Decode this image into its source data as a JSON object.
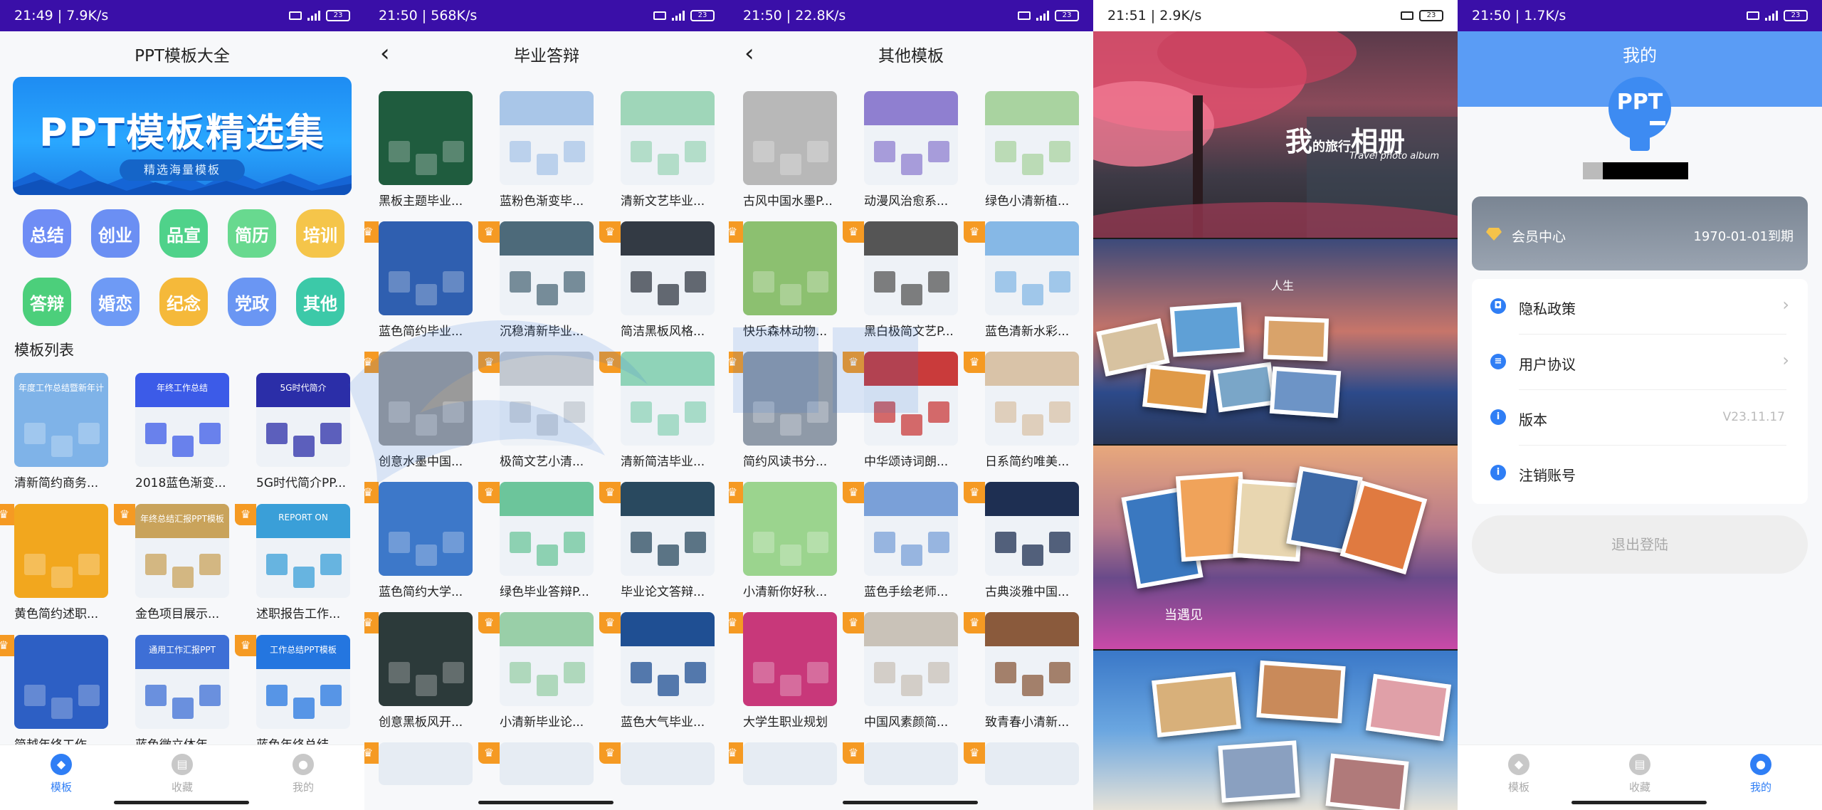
{
  "screens": [
    {
      "status": {
        "time": "21:49",
        "speed": "7.9K/s",
        "battery": "23"
      },
      "title": "PPT模板大全",
      "banner": {
        "title": "PPT模板精选集",
        "subtitle": "精选海量模板"
      },
      "categories": [
        {
          "label": "总结",
          "color": "#6f8df5"
        },
        {
          "label": "创业",
          "color": "#6b8ff3"
        },
        {
          "label": "品宣",
          "color": "#4fd28a"
        },
        {
          "label": "简历",
          "color": "#68d98f"
        },
        {
          "label": "培训",
          "color": "#f5c54a"
        },
        {
          "label": "答辩",
          "color": "#4ccf7b"
        },
        {
          "label": "婚恋",
          "color": "#6e9af5"
        },
        {
          "label": "纪念",
          "color": "#f5b93a"
        },
        {
          "label": "党政",
          "color": "#6a96f3"
        },
        {
          "label": "其他",
          "color": "#3cc9a8"
        }
      ],
      "section_title": "模板列表",
      "templates": [
        {
          "caption": "清新简约商务...",
          "vip": false,
          "theme": "#7fb3e8",
          "text": "年度工作总结暨新年计划"
        },
        {
          "caption": "2018蓝色渐变...",
          "vip": false,
          "theme": "#3c5be8",
          "text": "年终工作总结"
        },
        {
          "caption": "5G时代简介PP...",
          "vip": false,
          "theme": "#2b2ea8",
          "text": "5G时代简介"
        },
        {
          "caption": "黄色简约述职...",
          "vip": true,
          "theme": "#f2a71e",
          "text": ""
        },
        {
          "caption": "金色项目展示...",
          "vip": true,
          "theme": "#c9a35b",
          "text": "年终总结汇报PPT模板"
        },
        {
          "caption": "述职报告工作...",
          "vip": true,
          "theme": "#3a9fd8",
          "text": "REPORT ON"
        },
        {
          "caption": "简越年终工作...",
          "vip": true,
          "theme": "#2d5fc4",
          "text": ""
        },
        {
          "caption": "蓝色微立体年...",
          "vip": false,
          "theme": "#3e6fd6",
          "text": "通用工作汇报PPT"
        },
        {
          "caption": "蓝色年终总结...",
          "vip": true,
          "theme": "#2476e0",
          "text": "工作总结PPT模板"
        }
      ],
      "tabs": [
        {
          "label": "模板",
          "icon": "cube-icon"
        },
        {
          "label": "收藏",
          "icon": "document-icon"
        },
        {
          "label": "我的",
          "icon": "user-icon"
        }
      ],
      "active_tab": 0
    },
    {
      "status": {
        "time": "21:50",
        "speed": "568K/s",
        "battery": "23"
      },
      "title": "毕业答辩",
      "templates": [
        {
          "caption": "黑板主题毕业...",
          "vip": false,
          "theme": "#1f5c3e"
        },
        {
          "caption": "蓝粉色渐变毕...",
          "vip": false,
          "theme": "#a9c6e8"
        },
        {
          "caption": "清新文艺毕业...",
          "vip": false,
          "theme": "#9fd6b9"
        },
        {
          "caption": "蓝色简约毕业...",
          "vip": true,
          "theme": "#2f5fb0"
        },
        {
          "caption": "沉稳清新毕业...",
          "vip": true,
          "theme": "#4d6a7a"
        },
        {
          "caption": "简洁黑板风格...",
          "vip": true,
          "theme": "#333a44"
        },
        {
          "caption": "创意水墨中国...",
          "vip": true,
          "theme": "#9a9a9a"
        },
        {
          "caption": "极简文艺小清...",
          "vip": true,
          "theme": "#c2c8d0"
        },
        {
          "caption": "清新简洁毕业...",
          "vip": true,
          "theme": "#8fd3b8"
        },
        {
          "caption": "蓝色简约大学...",
          "vip": true,
          "theme": "#3d78c9"
        },
        {
          "caption": "绿色毕业答辩P...",
          "vip": true,
          "theme": "#6cc59b"
        },
        {
          "caption": "毕业论文答辩...",
          "vip": true,
          "theme": "#29495f"
        },
        {
          "caption": "创意黑板风开...",
          "vip": true,
          "theme": "#2c3a3a"
        },
        {
          "caption": "小清新毕业论...",
          "vip": true,
          "theme": "#99cfa8"
        },
        {
          "caption": "蓝色大气毕业...",
          "vip": true,
          "theme": "#1f4f93"
        }
      ]
    },
    {
      "status": {
        "time": "21:50",
        "speed": "22.8K/s",
        "battery": "23"
      },
      "title": "其他模板",
      "templates": [
        {
          "caption": "古风中国水墨P...",
          "vip": false,
          "theme": "#b8b8b8"
        },
        {
          "caption": "动漫风治愈系...",
          "vip": false,
          "theme": "#8f7fd0"
        },
        {
          "caption": "绿色小清新植...",
          "vip": false,
          "theme": "#a9d3a0"
        },
        {
          "caption": "快乐森林动物...",
          "vip": true,
          "theme": "#8cc070"
        },
        {
          "caption": "黑白极简文艺P...",
          "vip": true,
          "theme": "#555555"
        },
        {
          "caption": "蓝色清新水彩...",
          "vip": true,
          "theme": "#86b8e6"
        },
        {
          "caption": "简约风读书分...",
          "vip": true,
          "theme": "#8f9aa8"
        },
        {
          "caption": "中华颂诗词朗...",
          "vip": true,
          "theme": "#c93b3b"
        },
        {
          "caption": "日系简约唯美...",
          "vip": true,
          "theme": "#d9c3a8"
        },
        {
          "caption": "小清新你好秋...",
          "vip": true,
          "theme": "#9bd48e"
        },
        {
          "caption": "蓝色手绘老师...",
          "vip": true,
          "theme": "#7aa0d8"
        },
        {
          "caption": "古典淡雅中国...",
          "vip": true,
          "theme": "#1e2f52"
        },
        {
          "caption": "大学生职业规划",
          "vip": true,
          "theme": "#c8387a"
        },
        {
          "caption": "中国风素颜简...",
          "vip": true,
          "theme": "#c9c2b8"
        },
        {
          "caption": "致青春小清新...",
          "vip": true,
          "theme": "#8a5a3c"
        }
      ]
    },
    {
      "status": {
        "time": "21:51",
        "speed": "2.9K/s",
        "battery": "23"
      },
      "album": {
        "title_a": "我",
        "title_small": "的旅行",
        "title_b": "相册",
        "subtitle": "Travel photo album",
        "quote": "人生",
        "caption_2": "当遇见"
      }
    },
    {
      "status": {
        "time": "21:50",
        "speed": "1.7K/s",
        "battery": "23"
      },
      "title": "我的",
      "avatar_text": "PPT",
      "vip": {
        "label": "会员中心",
        "expire": "1970-01-01到期"
      },
      "menu": [
        {
          "label": "隐私政策",
          "value": "",
          "arrow": true,
          "icon": "shield-icon"
        },
        {
          "label": "用户协议",
          "value": "",
          "arrow": true,
          "icon": "document-icon"
        },
        {
          "label": "版本",
          "value": "V23.11.17",
          "arrow": false,
          "icon": "info-icon"
        },
        {
          "label": "注销账号",
          "value": "",
          "arrow": false,
          "icon": "info-icon"
        }
      ],
      "logout": "退出登陆",
      "tabs": [
        {
          "label": "模板",
          "icon": "cube-icon"
        },
        {
          "label": "收藏",
          "icon": "document-icon"
        },
        {
          "label": "我的",
          "icon": "user-icon"
        }
      ],
      "active_tab": 2
    }
  ]
}
